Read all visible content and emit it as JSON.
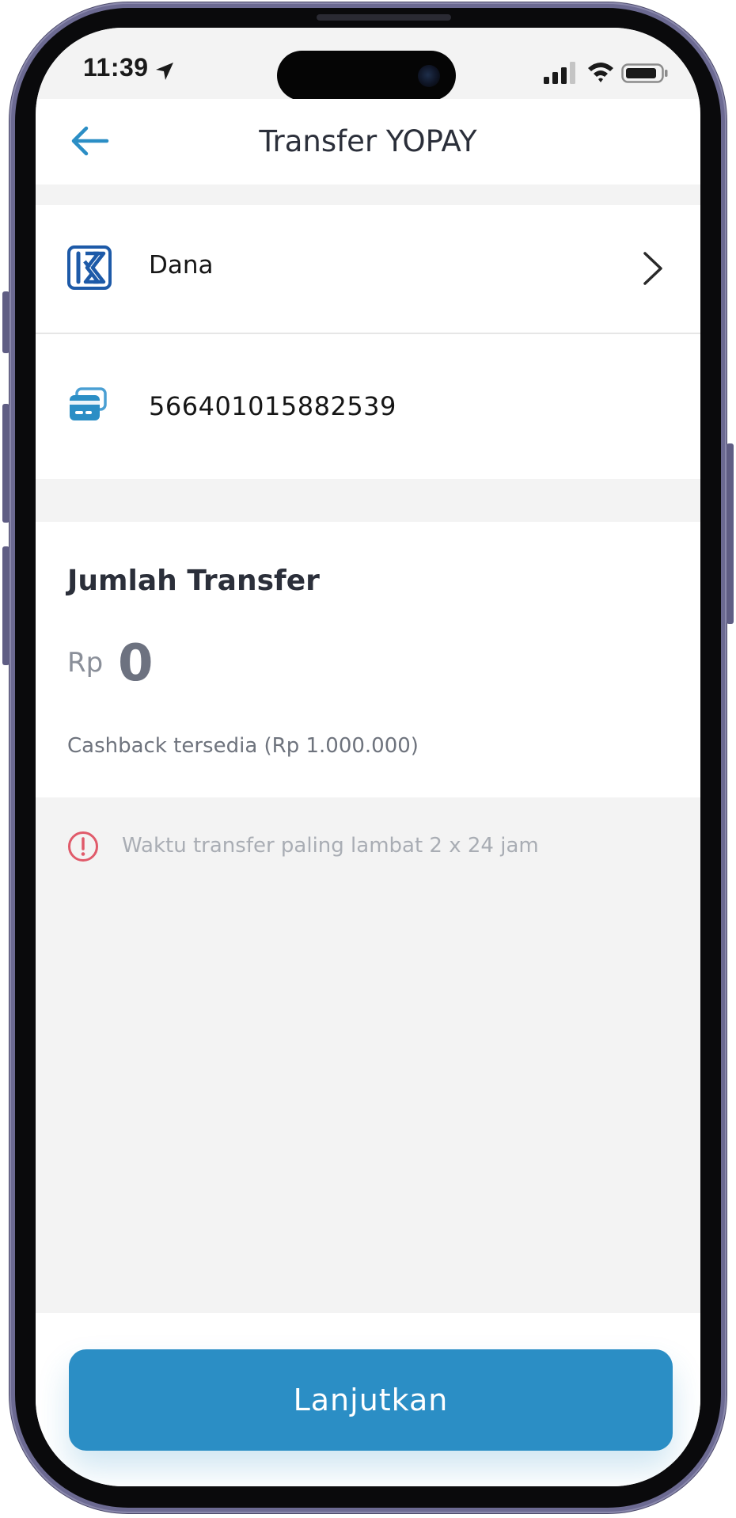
{
  "status_bar": {
    "time": "11:39",
    "icons": [
      "location-arrow-icon",
      "cellular-signal-icon",
      "wifi-icon",
      "battery-icon"
    ]
  },
  "header": {
    "title": "Transfer YOPAY",
    "back_icon": "arrow-left-icon"
  },
  "destination": {
    "bank_name": "Dana",
    "bank_logo": "bank-logo-icon",
    "account_number": "566401015882539",
    "account_icon": "card-icon"
  },
  "amount": {
    "heading": "Jumlah Transfer",
    "currency": "Rp",
    "value": "0",
    "cashback": "Cashback tersedia (Rp 1.000.000)"
  },
  "notice": {
    "text": "Waktu transfer paling lambat 2 x 24 jam",
    "icon": "alert-circle-icon"
  },
  "footer": {
    "continue_label": "Lanjutkan"
  },
  "colors": {
    "accent": "#2b8ec5",
    "bank_logo": "#1d5aa8",
    "alert": "#e05a6a",
    "screen_background": "#f3f3f3",
    "frame": "#6c6a92"
  }
}
